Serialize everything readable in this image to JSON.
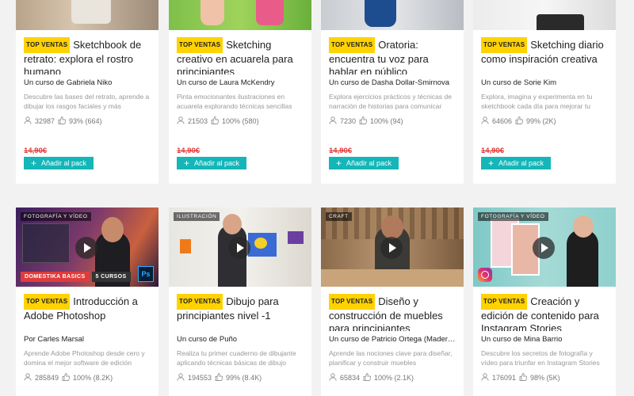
{
  "colors": {
    "accent": "#15b6b8",
    "badge": "#ffd200",
    "price": "#e03b3b"
  },
  "top_badge": "TOP VENTAS",
  "cards": [
    {
      "title": "Sketchbook de retrato: explora el rostro humano",
      "author": "Un curso de Gabriela Niko",
      "description": "Descubre las bases del retrato, aprende a dibujar los rasgos faciales y más",
      "students": "32987",
      "rating": "93% (664)",
      "price": "14,90€",
      "add_label": "Añadir al pack"
    },
    {
      "title": "Sketching creativo en acuarela para principiantes",
      "author": "Un curso de Laura McKendry",
      "description": "Pinta emocionantes ilustraciones en acuarela explorando técnicas sencillas",
      "students": "21503",
      "rating": "100% (580)",
      "price": "14,90€",
      "add_label": "Añadir al pack"
    },
    {
      "title": "Oratoria: encuentra tu voz para hablar en público",
      "author": "Un curso de Dasha Dollar-Smirnova",
      "description": "Explora ejercicios prácticos y técnicas de narración de historias para comunicar",
      "students": "7230",
      "rating": "100% (94)",
      "price": "14,90€",
      "add_label": "Añadir al pack"
    },
    {
      "title": "Sketching diario como inspiración creativa",
      "author": "Un curso de Sorie Kim",
      "description": "Explora, imagina y experimenta en tu sketchbook cada día para mejorar tu práctica",
      "students": "64606",
      "rating": "99% (2K)",
      "price": "14,90€",
      "add_label": "Añadir al pack"
    },
    {
      "category": "FOTOGRAFÍA Y VÍDEO",
      "tags": [
        "DOMESTIKA BASICS",
        "5 CURSOS"
      ],
      "app_icon": "Ps",
      "title": "Introducción a Adobe Photoshop",
      "author": "Por Carles Marsal",
      "description": "Aprende Adobe Photoshop desde cero y domina el mejor software de edición",
      "students": "285849",
      "rating": "100% (8.2K)"
    },
    {
      "category": "ILUSTRACIÓN",
      "title": "Dibujo para principiantes nivel -1",
      "author": "Un curso de Puño",
      "description": "Realiza tu primer cuaderno de dibujante aplicando técnicas básicas de dibujo",
      "students": "194553",
      "rating": "99% (8.4K)"
    },
    {
      "category": "CRAFT",
      "title": "Diseño y construcción de muebles para principiantes",
      "author": "Un curso de Patricio Ortega (Madera Ostra)",
      "description": "Aprende las nociones clave para diseñar, planificar y construir muebles",
      "students": "65834",
      "rating": "100% (2.1K)"
    },
    {
      "category": "FOTOGRAFÍA Y VÍDEO",
      "title": "Creación y edición de contenido para Instagram Stories",
      "author": "Un curso de Mina Barrio",
      "description": "Descubre los secretos de fotografía y vídeo para triunfar en Instagram Stories",
      "students": "176091",
      "rating": "98% (5K)"
    }
  ]
}
